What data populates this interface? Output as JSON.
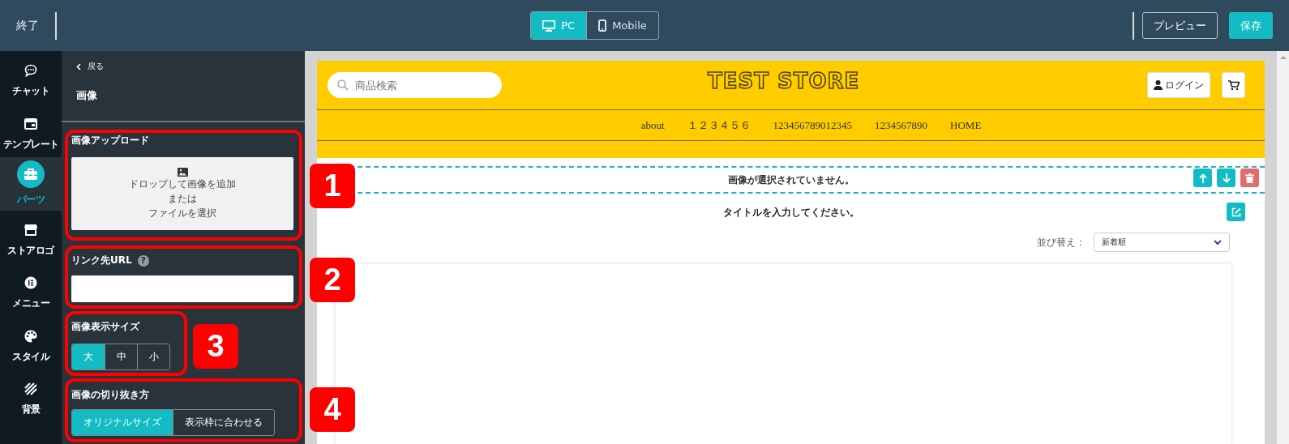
{
  "topbar": {
    "exit": "終了",
    "view_toggle": [
      {
        "label": "PC",
        "selected": true
      },
      {
        "label": "Mobile",
        "selected": false
      }
    ],
    "preview": "プレビュー",
    "save": "保存"
  },
  "rail": [
    {
      "label": "チャット",
      "selected": false
    },
    {
      "label": "テンプレート",
      "selected": false
    },
    {
      "label": "パーツ",
      "selected": true
    },
    {
      "label": "ストアロゴ",
      "selected": false
    },
    {
      "label": "メニュー",
      "selected": false
    },
    {
      "label": "スタイル",
      "selected": false
    },
    {
      "label": "背景",
      "selected": false
    }
  ],
  "panel": {
    "back": "戻る",
    "title": "画像",
    "upload": {
      "heading": "画像アップロード",
      "lines": [
        "ドロップして画像を追加",
        "または",
        "ファイルを選択"
      ]
    },
    "link": {
      "heading": "リンク先URL",
      "help": "?"
    },
    "size": {
      "heading": "画像表示サイズ",
      "options": [
        {
          "label": "大",
          "selected": true
        },
        {
          "label": "中",
          "selected": false
        },
        {
          "label": "小",
          "selected": false
        }
      ]
    },
    "crop": {
      "heading": "画像の切り抜き方",
      "options": [
        {
          "label": "オリジナルサイズ",
          "selected": true
        },
        {
          "label": "表示枠に合わせる",
          "selected": false
        }
      ]
    }
  },
  "store": {
    "search_placeholder": "商品検索",
    "logo": "TEST STORE",
    "login": "ログイン",
    "nav": [
      "about",
      "１２３４５６",
      "123456789012345",
      "1234567890",
      "HOME"
    ],
    "image_notice": "画像が選択されていません。",
    "title_prompt": "タイトルを入力してください。",
    "sort_label": "並び替え：",
    "sort_value": "新着順"
  },
  "annotations": [
    {
      "label": "1"
    },
    {
      "label": "2"
    },
    {
      "label": "3"
    },
    {
      "label": "4"
    }
  ]
}
